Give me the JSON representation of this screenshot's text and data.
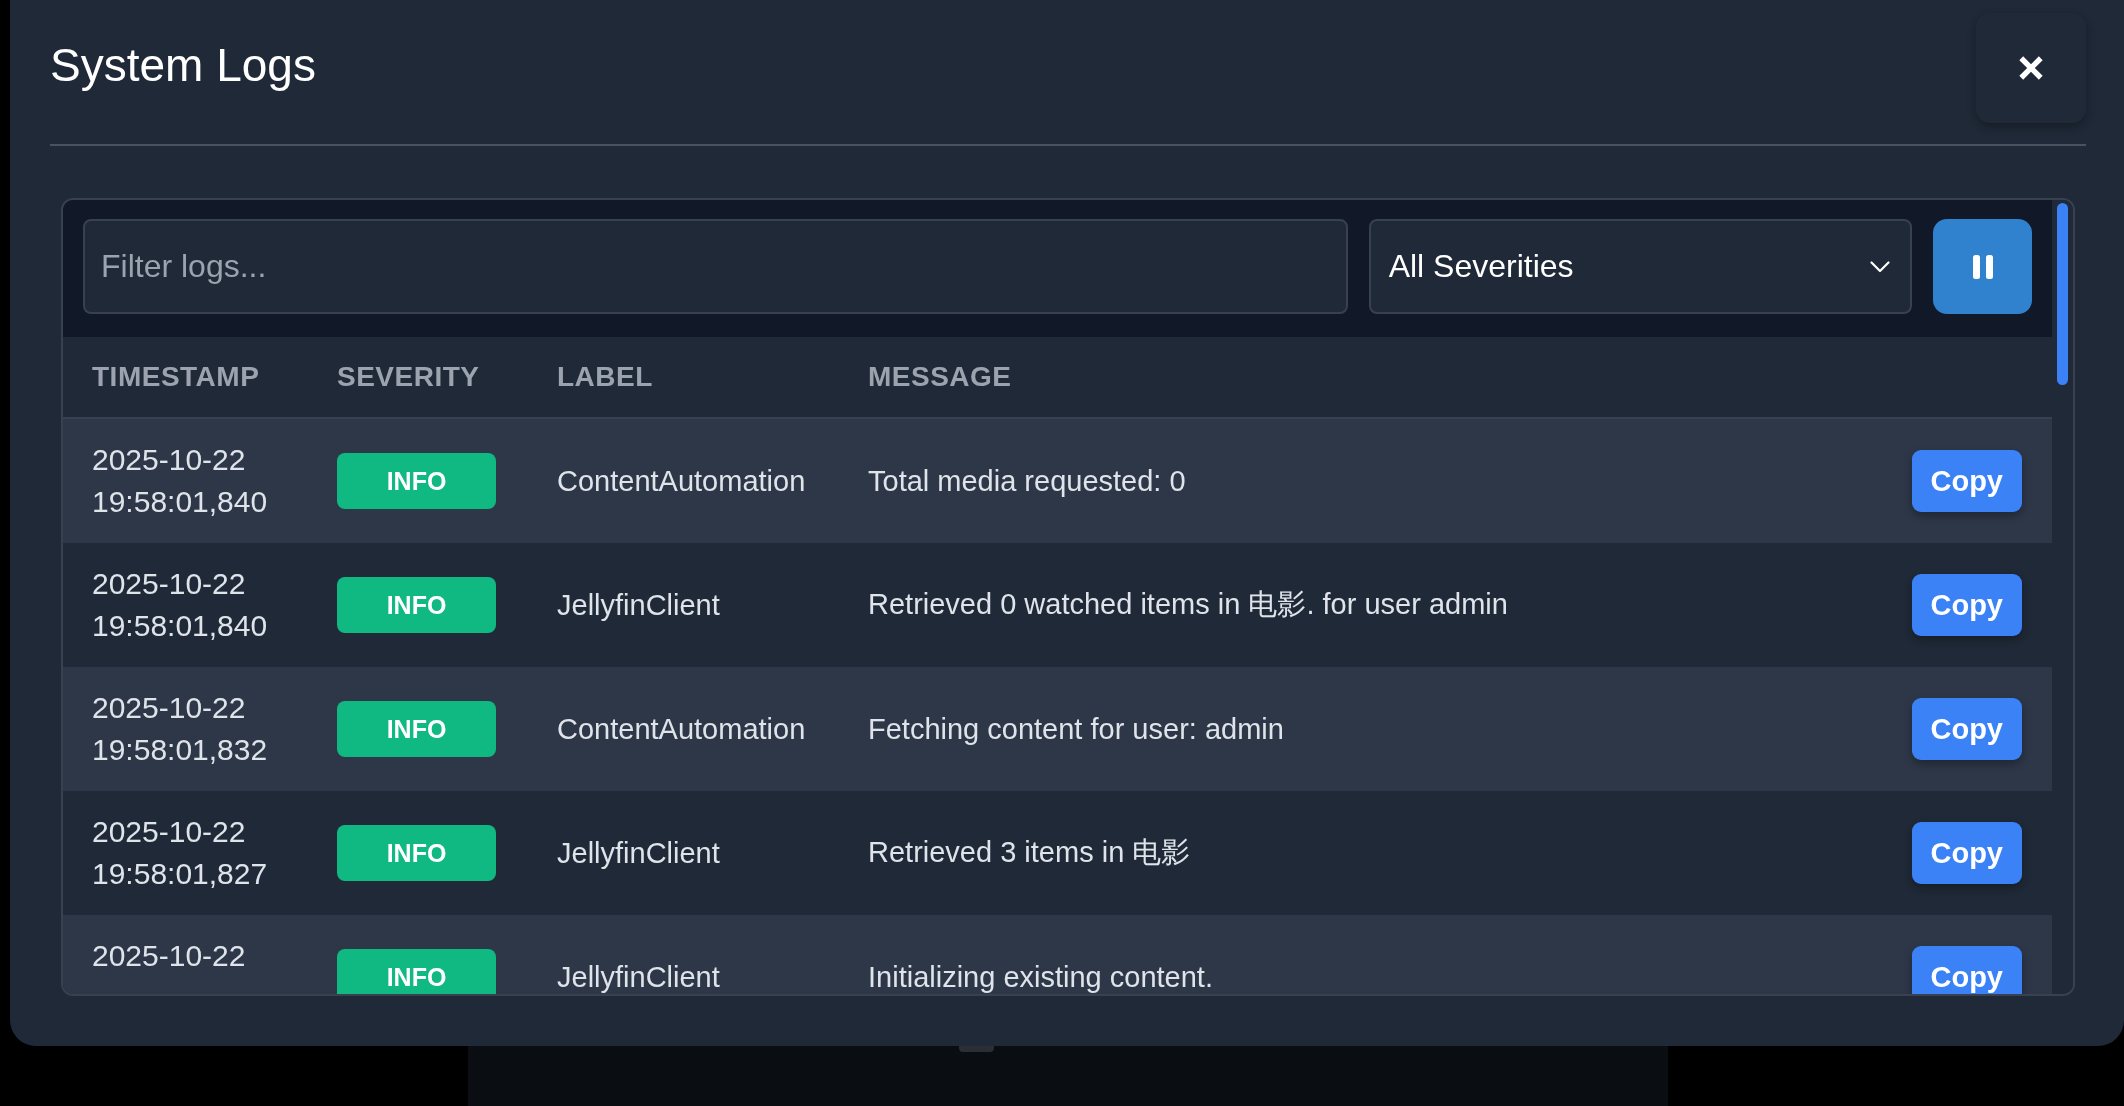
{
  "dialog": {
    "title": "System Logs"
  },
  "toolbar": {
    "filter": {
      "placeholder": "Filter logs..."
    },
    "severity_filter": {
      "value": "All Severities"
    },
    "pause_button": {
      "paused": false
    }
  },
  "table": {
    "columns": [
      "TIMESTAMP",
      "SEVERITY",
      "LABEL",
      "MESSAGE"
    ],
    "rows": [
      {
        "timestamp": "2025-10-22 19:58:01,840",
        "severity": "INFO",
        "label": "ContentAutomation",
        "message": "Total media requested: 0",
        "action": "Copy"
      },
      {
        "timestamp": "2025-10-22 19:58:01,840",
        "severity": "INFO",
        "label": "JellyfinClient",
        "message": "Retrieved 0 watched items in 电影. for user admin",
        "action": "Copy"
      },
      {
        "timestamp": "2025-10-22 19:58:01,832",
        "severity": "INFO",
        "label": "ContentAutomation",
        "message": "Fetching content for user: admin",
        "action": "Copy"
      },
      {
        "timestamp": "2025-10-22 19:58:01,827",
        "severity": "INFO",
        "label": "JellyfinClient",
        "message": "Retrieved 3 items in 电影",
        "action": "Copy"
      },
      {
        "timestamp": "2025-10-22",
        "severity": "INFO",
        "label": "JellyfinClient",
        "message": "Initializing existing content.",
        "action": "Copy"
      }
    ]
  }
}
